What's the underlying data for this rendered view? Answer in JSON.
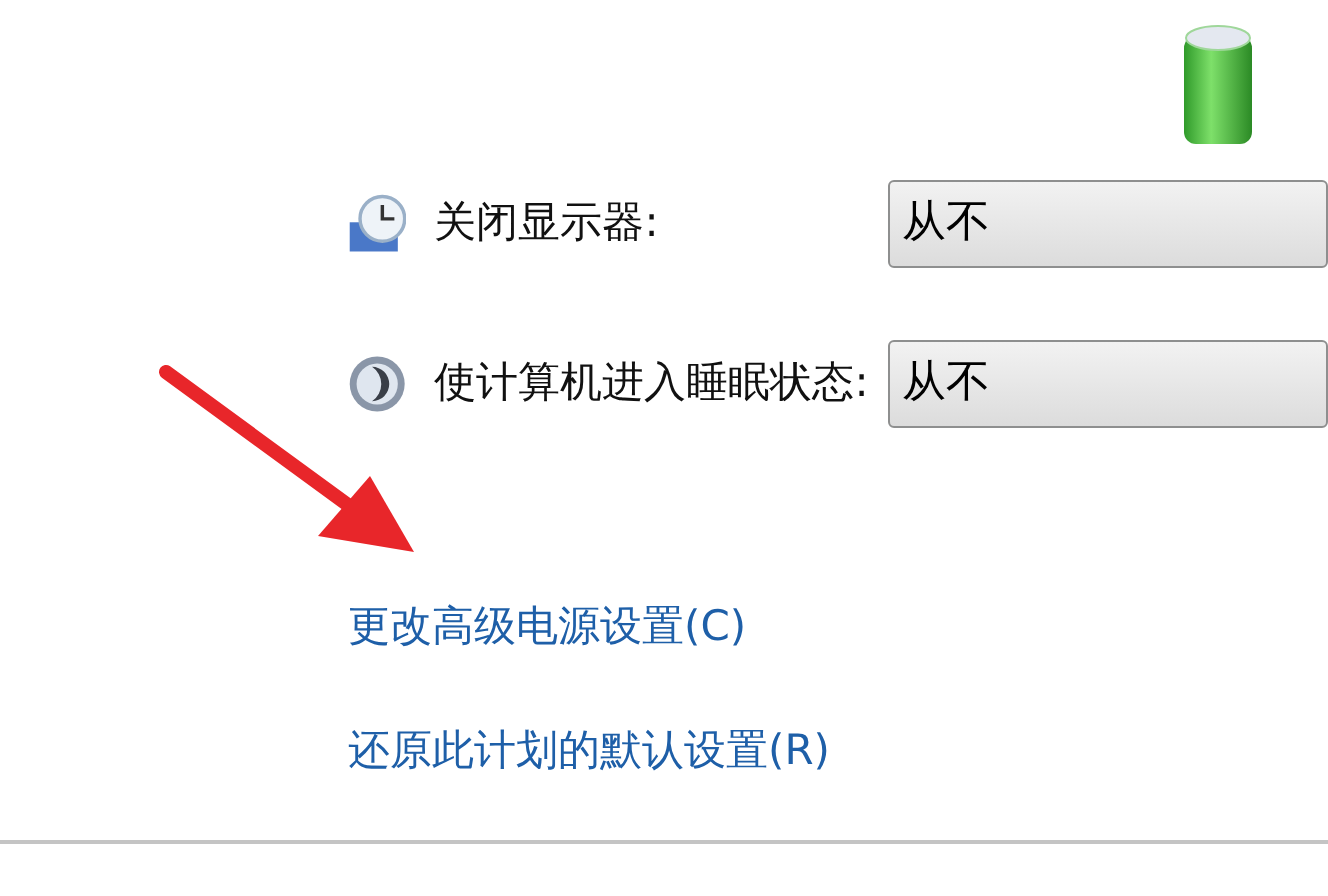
{
  "settings": [
    {
      "kind": "display",
      "label": "关闭显示器:",
      "value": "从不"
    },
    {
      "kind": "sleep",
      "label": "使计算机进入睡眠状态:",
      "value": "从不"
    }
  ],
  "links": [
    "更改高级电源设置(C)",
    "还原此计划的默认设置(R)"
  ]
}
